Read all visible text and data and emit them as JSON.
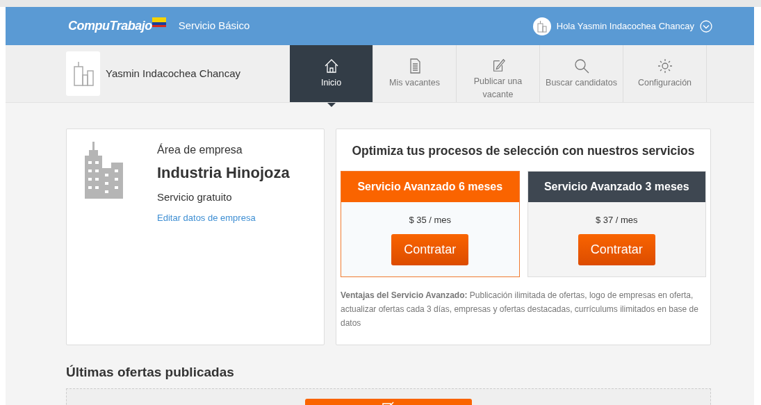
{
  "header": {
    "logo": "CompuTrabajo",
    "plan": "Servicio Básico",
    "greeting": "Hola Yasmin Indacochea Chancay"
  },
  "company_bar": {
    "name": "Yasmin Indacochea Chancay"
  },
  "nav": [
    {
      "label": "Inicio",
      "kind": "home",
      "selected": true
    },
    {
      "label": "Mis vacantes",
      "kind": "document",
      "selected": false
    },
    {
      "label": "Publicar una vacante",
      "kind": "edit",
      "selected": false
    },
    {
      "label": "Buscar candidatos",
      "kind": "search",
      "selected": false
    },
    {
      "label": "Configuración",
      "kind": "gear",
      "selected": false
    }
  ],
  "company_card": {
    "area_label": "Área de empresa",
    "company_name": "Industria Hinojoza",
    "plan": "Servicio gratuito",
    "edit_link": "Editar datos de empresa"
  },
  "promo": {
    "title": "Optimiza tus procesos de selección con nuestros servicios",
    "plans": [
      {
        "title": "Servicio Avanzado 6 meses",
        "price": "$ 35 / mes",
        "button": "Contratar",
        "featured": true
      },
      {
        "title": "Servicio Avanzado 3 meses",
        "price": "$ 37 / mes",
        "button": "Contratar",
        "featured": false
      }
    ],
    "benefits": "**Ventajas del Servicio Avanzado:** Publicación ilimitada de ofertas, logo de empresas en oferta, actualizar ofertas cada 3 días, empresas y ofertas destacadas, currículums ilimitados en base de datos"
  },
  "latest": {
    "title": "Últimas ofertas publicadas"
  }
}
